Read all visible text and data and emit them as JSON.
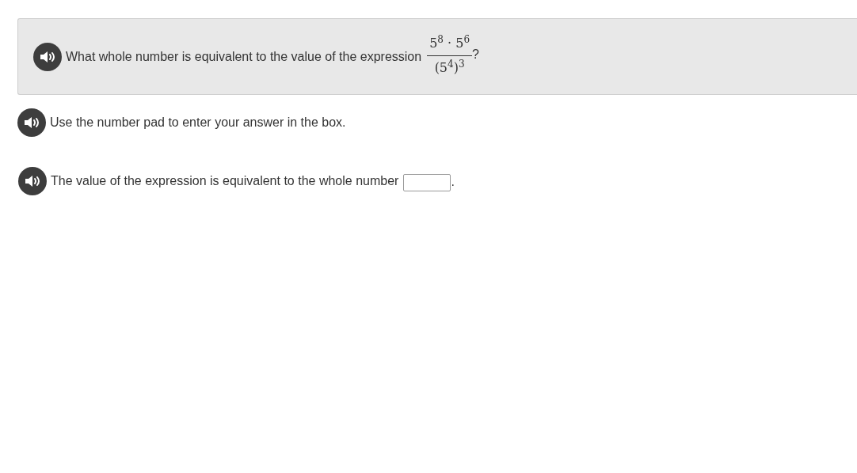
{
  "question": {
    "text": "What whole number is equivalent to the value of the expression",
    "fraction": {
      "numerator": "5$^{8}$ · 5$^{6}$",
      "denominator": "(5$^{4}$)$^{3}$"
    },
    "end": "?"
  },
  "instruction": {
    "text": "Use the number pad to enter your answer in the box."
  },
  "answer_line": {
    "text": "The value of the expression is equivalent to the whole number",
    "end": "."
  }
}
